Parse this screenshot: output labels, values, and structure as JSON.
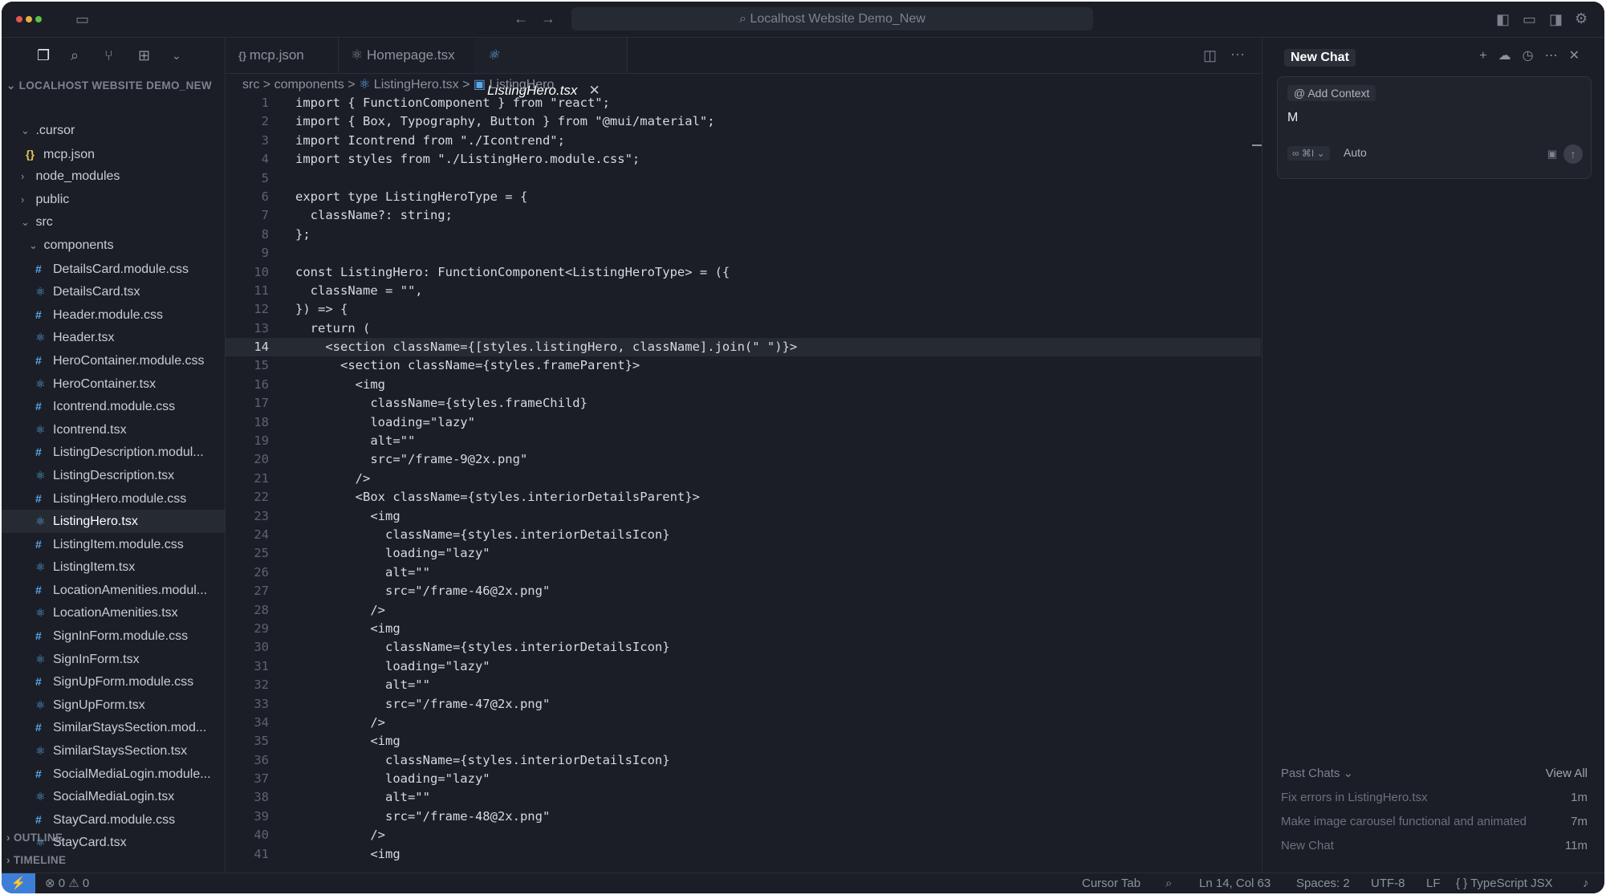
{
  "window": {
    "search_label": "Localhost Website Demo_New",
    "traffic_colors": [
      "#e5554f",
      "#e3b13e",
      "#5cbf49"
    ]
  },
  "explorer": {
    "root_label": "LOCALHOST WEBSITE DEMO_NEW",
    "outline_label": "OUTLINE",
    "timeline_label": "TIMELINE",
    "items": [
      {
        "label": ".cursor",
        "kind": "folder-open",
        "depth": 1
      },
      {
        "label": "mcp.json",
        "kind": "json",
        "depth": 2
      },
      {
        "label": "node_modules",
        "kind": "folder",
        "depth": 1
      },
      {
        "label": "public",
        "kind": "folder",
        "depth": 1
      },
      {
        "label": "src",
        "kind": "folder-open",
        "depth": 1
      },
      {
        "label": "components",
        "kind": "folder-open",
        "depth": 2
      },
      {
        "label": "DetailsCard.module.css",
        "kind": "css",
        "depth": 3
      },
      {
        "label": "DetailsCard.tsx",
        "kind": "react",
        "depth": 3
      },
      {
        "label": "Header.module.css",
        "kind": "css",
        "depth": 3
      },
      {
        "label": "Header.tsx",
        "kind": "react",
        "depth": 3
      },
      {
        "label": "HeroContainer.module.css",
        "kind": "css",
        "depth": 3
      },
      {
        "label": "HeroContainer.tsx",
        "kind": "react",
        "depth": 3
      },
      {
        "label": "Icontrend.module.css",
        "kind": "css",
        "depth": 3
      },
      {
        "label": "Icontrend.tsx",
        "kind": "react",
        "depth": 3
      },
      {
        "label": "ListingDescription.modul...",
        "kind": "css",
        "depth": 3
      },
      {
        "label": "ListingDescription.tsx",
        "kind": "react",
        "depth": 3
      },
      {
        "label": "ListingHero.module.css",
        "kind": "css",
        "depth": 3
      },
      {
        "label": "ListingHero.tsx",
        "kind": "react",
        "depth": 3,
        "active": true
      },
      {
        "label": "ListingItem.module.css",
        "kind": "css",
        "depth": 3
      },
      {
        "label": "ListingItem.tsx",
        "kind": "react",
        "depth": 3
      },
      {
        "label": "LocationAmenities.modul...",
        "kind": "css",
        "depth": 3
      },
      {
        "label": "LocationAmenities.tsx",
        "kind": "react",
        "depth": 3
      },
      {
        "label": "SignInForm.module.css",
        "kind": "css",
        "depth": 3
      },
      {
        "label": "SignInForm.tsx",
        "kind": "react",
        "depth": 3
      },
      {
        "label": "SignUpForm.module.css",
        "kind": "css",
        "depth": 3
      },
      {
        "label": "SignUpForm.tsx",
        "kind": "react",
        "depth": 3
      },
      {
        "label": "SimilarStaysSection.mod...",
        "kind": "css",
        "depth": 3
      },
      {
        "label": "SimilarStaysSection.tsx",
        "kind": "react",
        "depth": 3
      },
      {
        "label": "SocialMediaLogin.module...",
        "kind": "css",
        "depth": 3
      },
      {
        "label": "SocialMediaLogin.tsx",
        "kind": "react",
        "depth": 3
      },
      {
        "label": "StayCard.module.css",
        "kind": "css",
        "depth": 3
      },
      {
        "label": "StayCard.tsx",
        "kind": "react",
        "depth": 3
      }
    ]
  },
  "tabs": [
    {
      "label": "mcp.json",
      "icon": "json"
    },
    {
      "label": "Homepage.tsx",
      "icon": "react"
    },
    {
      "label": "ListingHero.tsx",
      "icon": "react",
      "active": true
    }
  ],
  "breadcrumb": {
    "parts": [
      "src",
      "components",
      "ListingHero.tsx",
      "ListingHero"
    ],
    "separator": ">"
  },
  "code": {
    "current_line": 14,
    "lines": [
      "import { FunctionComponent } from \"react\";",
      "import { Box, Typography, Button } from \"@mui/material\";",
      "import Icontrend from \"./Icontrend\";",
      "import styles from \"./ListingHero.module.css\";",
      "",
      "export type ListingHeroType = {",
      "  className?: string;",
      "};",
      "",
      "const ListingHero: FunctionComponent<ListingHeroType> = ({",
      "  className = \"\",",
      "}) => {",
      "  return (",
      "    <section className={[styles.listingHero, className].join(\" \")}>",
      "      <section className={styles.frameParent}>",
      "        <img",
      "          className={styles.frameChild}",
      "          loading=\"lazy\"",
      "          alt=\"\"",
      "          src=\"/frame-9@2x.png\"",
      "        />",
      "        <Box className={styles.interiorDetailsParent}>",
      "          <img",
      "            className={styles.interiorDetailsIcon}",
      "            loading=\"lazy\"",
      "            alt=\"\"",
      "            src=\"/frame-46@2x.png\"",
      "          />",
      "          <img",
      "            className={styles.interiorDetailsIcon}",
      "            loading=\"lazy\"",
      "            alt=\"\"",
      "            src=\"/frame-47@2x.png\"",
      "          />",
      "          <img",
      "            className={styles.interiorDetailsIcon}",
      "            loading=\"lazy\"",
      "            alt=\"\"",
      "            src=\"/frame-48@2x.png\"",
      "          />",
      "          <img"
    ]
  },
  "chat": {
    "title": "New Chat",
    "add_context_label": "Add Context",
    "input_value": "M",
    "mode_label": "∞ ⌘I",
    "model_label": "Auto",
    "past_chats_label": "Past Chats",
    "view_all_label": "View All",
    "past_chats": [
      {
        "title": "Fix errors in ListingHero.tsx",
        "age": "1m"
      },
      {
        "title": "Make image carousel functional and animated",
        "age": "7m"
      },
      {
        "title": "New Chat",
        "age": "11m"
      }
    ]
  },
  "status": {
    "errors": "0",
    "warnings": "0",
    "cursor_tab": "Cursor Tab",
    "position": "Ln 14, Col 63",
    "spaces": "Spaces: 2",
    "encoding": "UTF-8",
    "eol": "LF",
    "language": "TypeScript JSX"
  }
}
